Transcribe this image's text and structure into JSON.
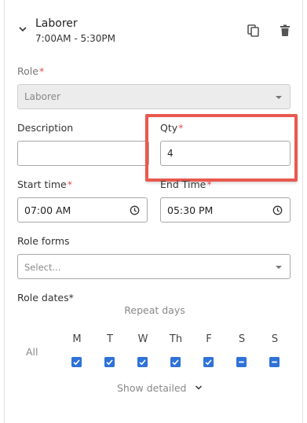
{
  "header": {
    "title": "Laborer",
    "time_range": "7:00AM - 5:30PM"
  },
  "role": {
    "label": "Role",
    "required": "*",
    "value": "Laborer"
  },
  "description": {
    "label": "Description",
    "value": ""
  },
  "qty": {
    "label": "Qty",
    "required": "*",
    "value": "4"
  },
  "start_time": {
    "label": "Start time",
    "required": "*",
    "value": "07:00 AM"
  },
  "end_time": {
    "label": "End Time",
    "required": "*",
    "value": "05:30 PM"
  },
  "role_forms": {
    "label": "Role forms",
    "placeholder": "Select..."
  },
  "role_dates": {
    "label": "Role dates",
    "required": "*",
    "repeat_days_label": "Repeat days",
    "all_label": "All",
    "days": [
      {
        "label": "M",
        "state": "checked"
      },
      {
        "label": "T",
        "state": "checked"
      },
      {
        "label": "W",
        "state": "checked"
      },
      {
        "label": "Th",
        "state": "checked"
      },
      {
        "label": "F",
        "state": "checked"
      },
      {
        "label": "S",
        "state": "indeterminate"
      },
      {
        "label": "S",
        "state": "indeterminate"
      }
    ],
    "show_detailed_label": "Show detailed"
  },
  "icons": {
    "collapse": "chevron-down-icon",
    "copy": "copy-icon",
    "delete": "trash-icon",
    "clock": "clock-icon"
  },
  "colors": {
    "highlight": "#e8594f",
    "checkbox": "#2f72d8",
    "required": "#e05050"
  }
}
